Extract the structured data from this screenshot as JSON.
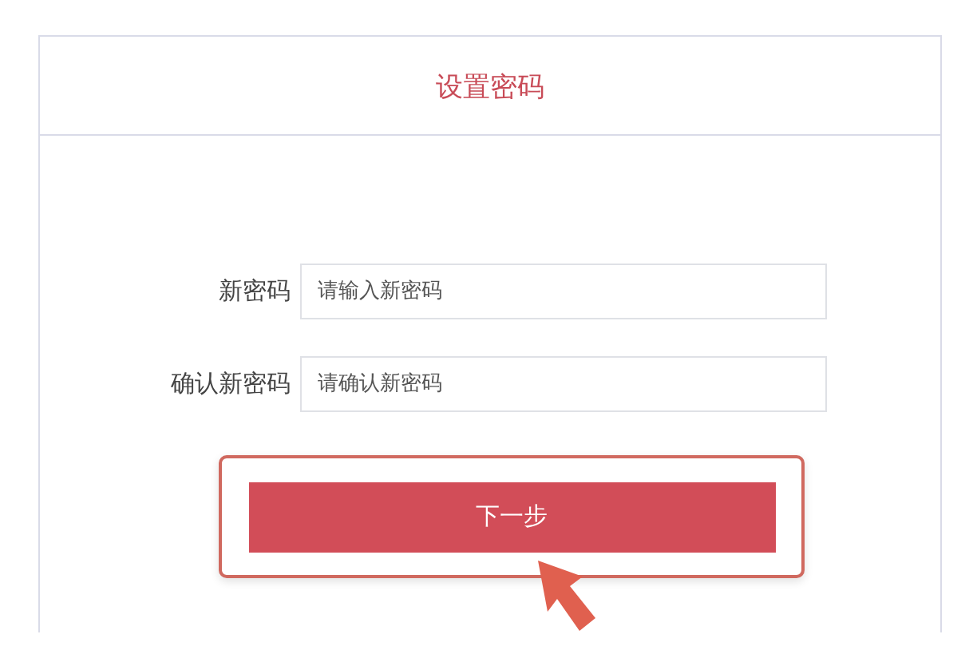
{
  "title": "设置密码",
  "fields": [
    {
      "label": "新密码",
      "placeholder": "请输入新密码"
    },
    {
      "label": "确认新密码",
      "placeholder": "请确认新密码"
    }
  ],
  "next_button": {
    "label": "下一步"
  }
}
